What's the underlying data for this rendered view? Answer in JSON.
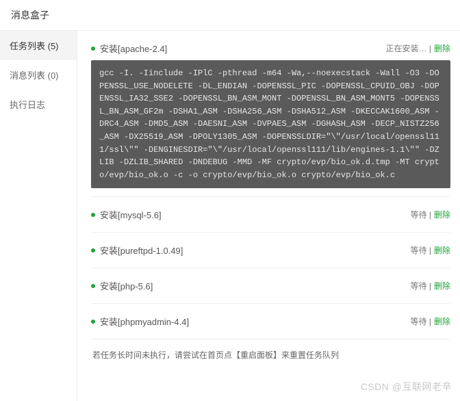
{
  "header": {
    "title": "消息盒子"
  },
  "sidebar": {
    "items": [
      {
        "label": "任务列表 (5)"
      },
      {
        "label": "消息列表 (0)"
      },
      {
        "label": "执行日志"
      }
    ]
  },
  "tasks": [
    {
      "title": "安装[apache-2.4]",
      "status": "正在安装… |",
      "delete": "删除",
      "console": "gcc -I. -Iinclude -IPlC -pthread -m64 -Wa,--noexecstack -Wall -O3 -DOPENSSL_USE_NODELETE -DL_ENDIAN -DOPENSSL_PIC -DOPENSSL_CPUID_OBJ -DOPENSSL_IA32_SSE2 -DOPENSSL_BN_ASM_MONT -DOPENSSL_BN_ASM_MONT5 -DOPENSSL_BN_ASM_GF2m -DSHA1_ASM -DSHA256_ASM -DSHA512_ASM -DKECCAK1600_ASM -DRC4_ASM -DMD5_ASM -DAESNI_ASM -DVPAES_ASM -DGHASH_ASM -DECP_NISTZ256_ASM -DX25519_ASM -DPOLY1305_ASM -DOPENSSLDIR=\"\\\"/usr/local/openssl111/ssl\\\"\" -DENGINESDIR=\"\\\"/usr/local/openssl111/lib/engines-1.1\\\"\" -DZLIB -DZLIB_SHARED -DNDEBUG  -MMD -MF crypto/evp/bio_ok.d.tmp -MT crypto/evp/bio_ok.o -c -o crypto/evp/bio_ok.o crypto/evp/bio_ok.c"
    },
    {
      "title": "安装[mysql-5.6]",
      "status": "等待 |",
      "delete": "删除"
    },
    {
      "title": "安装[pureftpd-1.0.49]",
      "status": "等待 |",
      "delete": "删除"
    },
    {
      "title": "安装[php-5.6]",
      "status": "等待 |",
      "delete": "删除"
    },
    {
      "title": "安装[phpmyadmin-4.4]",
      "status": "等待 |",
      "delete": "删除"
    }
  ],
  "footer": {
    "note": "若任务长时间未执行，请尝试在首页点【重启面板】来重置任务队列"
  },
  "watermark": "CSDN @互联网老辛"
}
